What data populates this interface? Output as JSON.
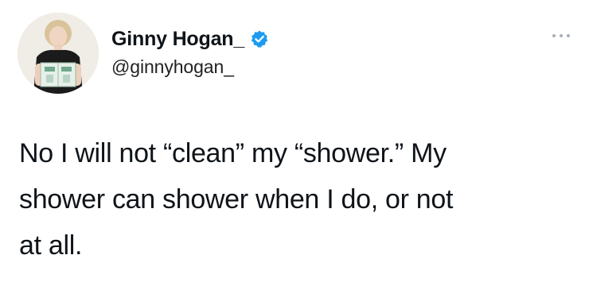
{
  "tweet": {
    "author": {
      "display_name": "Ginny Hogan_",
      "handle": "@ginnyhogan_",
      "verified_icon": "verified-badge-icon",
      "verified_color": "#1d9bf0",
      "avatar_icon": "profile-photo-avatar"
    },
    "more_icon": "more-options-icon",
    "text_lines": [
      "No I will not “clean” my “shower.” My",
      "shower can shower when I do, or not",
      "at all."
    ]
  }
}
